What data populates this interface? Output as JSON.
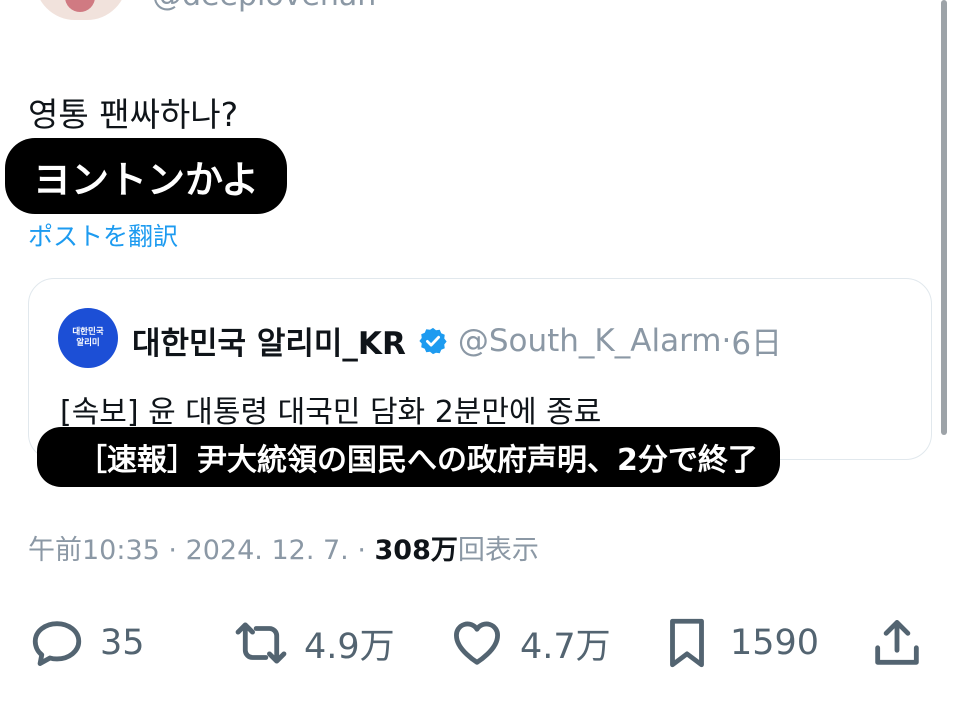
{
  "author": {
    "handle": "@deeplovehan"
  },
  "tweet": {
    "text": "영통 팬싸하나?",
    "caption": "ヨントンかよ",
    "translate_link": "ポストを翻訳"
  },
  "quote": {
    "avatar_line1": "대한민국",
    "avatar_line2": "알리미",
    "name": "대한민국 알리미_KR",
    "handle": "@South_K_Alarm",
    "time": "6日",
    "text": "[속보] 윤 대통령 대국민 담화 2분만에 종료",
    "caption": "［速報］尹大統領の国民への政府声明、2分で終了"
  },
  "meta": {
    "time": "午前10:35",
    "date": "2024. 12. 7.",
    "views": "308万",
    "views_label": "回表示"
  },
  "actions": {
    "reply": {
      "icon": "reply-icon",
      "count": "35"
    },
    "repost": {
      "icon": "repost-icon",
      "count": "4.9万"
    },
    "like": {
      "icon": "heart-icon",
      "count": "4.7万"
    },
    "bookmark": {
      "icon": "bookmark-icon",
      "count": "1590"
    },
    "share": {
      "icon": "share-icon"
    }
  },
  "colors": {
    "link": "#1d9bf0",
    "secondary_text": "#8b98a5",
    "icon": "#536471",
    "verified": "#1d9bf0",
    "caption_bg": "#000000"
  }
}
